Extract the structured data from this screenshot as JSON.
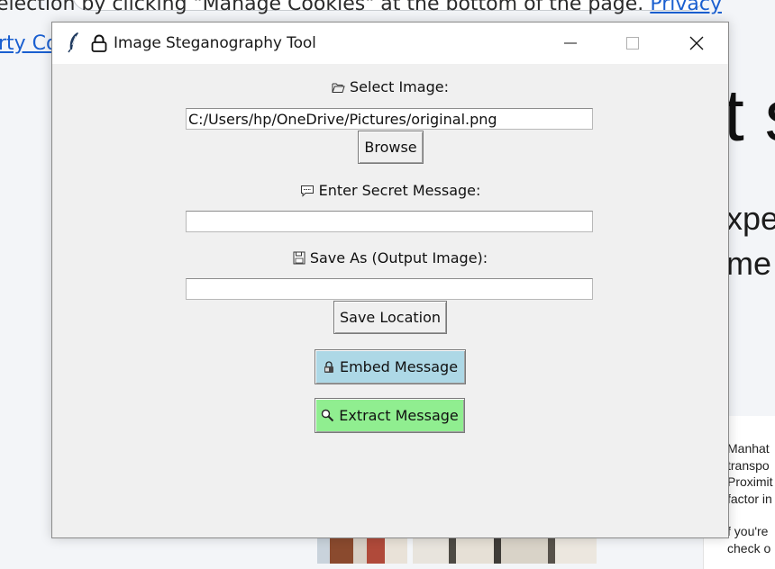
{
  "background": {
    "top_text": "election by clicking \"Manage Cookies\" at the bottom of the page.",
    "top_link": "Privacy",
    "second_link": "rty Co",
    "headline": "t s",
    "sub_line_1": "xpe",
    "sub_line_2": "me",
    "para_lines": [
      "Manhat",
      "transpo",
      "Proximit",
      "factor in",
      "",
      "f you're",
      "check o"
    ]
  },
  "window": {
    "title": "Image Steganography Tool",
    "controls": {
      "minimize": "—",
      "maximize": "☐",
      "close": "✕"
    }
  },
  "form": {
    "select_image_label": "Select Image:",
    "image_path_value": "C:/Users/hp/OneDrive/Pictures/original.png",
    "browse_label": "Browse",
    "secret_message_label": "Enter Secret Message:",
    "secret_message_value": "",
    "save_as_label": "Save As (Output Image):",
    "output_path_value": "",
    "save_location_label": "Save Location",
    "embed_label": "Embed Message",
    "extract_label": "Extract Message"
  },
  "colors": {
    "embed_button": "#add8e6",
    "extract_button": "#90ee90",
    "link": "#1a5fd0"
  },
  "icons": {
    "select_image": "open-folder-icon",
    "secret_message": "speech-bubble-icon",
    "save_as": "floppy-disk-icon",
    "embed": "lock-icon",
    "extract": "magnifier-icon"
  }
}
